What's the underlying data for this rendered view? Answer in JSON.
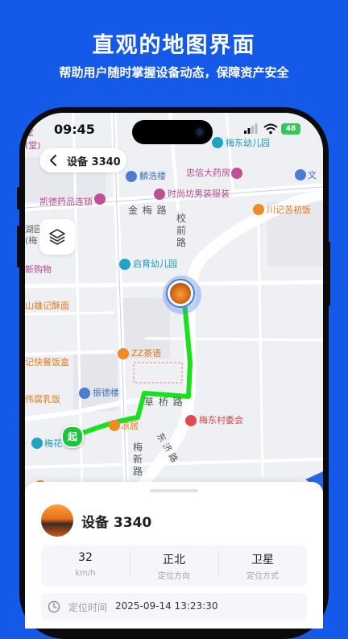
{
  "promo": {
    "title": "直观的地图界面",
    "subtitle": "帮助用户随时掌握设备动态，保障资产安全"
  },
  "status_bar": {
    "time": "09:45",
    "battery": "48"
  },
  "header": {
    "title": "设备 3340"
  },
  "map": {
    "pois": [
      "梅东幼儿园",
      "麟浩楼",
      "忠信大药房",
      "文",
      "凯德药品连锁",
      "时尚坊男装服装",
      "川记苦初饭",
      "启育幼儿园",
      "ZZ茶语",
      "振德楼",
      "梅东村委会",
      "凉居",
      "梅花",
      "新购物",
      "山雄记酥面",
      "记快餐饭盒",
      "伟腐乳饭",
      "湖园",
      "(梅",
      "堂",
      "(堂)"
    ],
    "roads": [
      "金 梅 路",
      "校前路",
      "草 桥 路",
      "梅新路",
      "东 济 路"
    ],
    "start_marker": "起"
  },
  "device": {
    "name": "设备 3340",
    "speed": {
      "value": "32",
      "label": "km/h"
    },
    "direction": {
      "value": "正北",
      "label": "定位方向"
    },
    "method": {
      "value": "卫星",
      "label": "定位方式"
    },
    "time": {
      "label": "定位时间",
      "value": "2025-09-14 13:23:30"
    }
  },
  "colors": {
    "brand": "#1559e8",
    "track": "#19e11e",
    "device_ring": "#3f7ae6"
  }
}
